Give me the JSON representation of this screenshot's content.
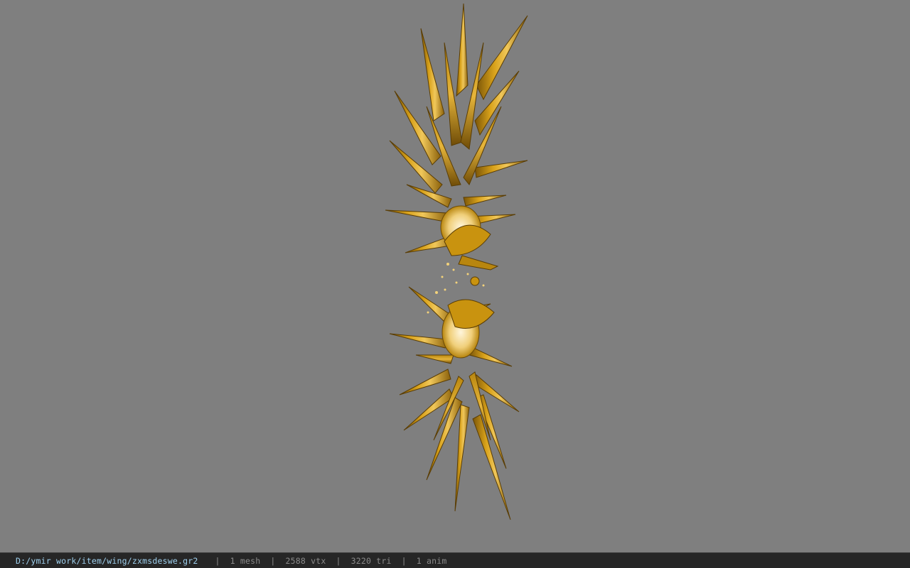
{
  "viewport": {
    "background": "#7f7f7f",
    "model_icon": "golden-wing-model",
    "model_colors": {
      "gold_dark": "#6b4a06",
      "gold_mid": "#c9930f",
      "gold_light": "#f3d27a",
      "highlight": "#fff3d0"
    }
  },
  "status_bar": {
    "file_path": "D:/ymir work/item/wing/zxmsdeswe.gr2",
    "separator": "|",
    "mesh_count": "1 mesh",
    "vertex_count": "2588 vtx",
    "triangle_count": "3220 tri",
    "anim_count": "1 anim"
  }
}
